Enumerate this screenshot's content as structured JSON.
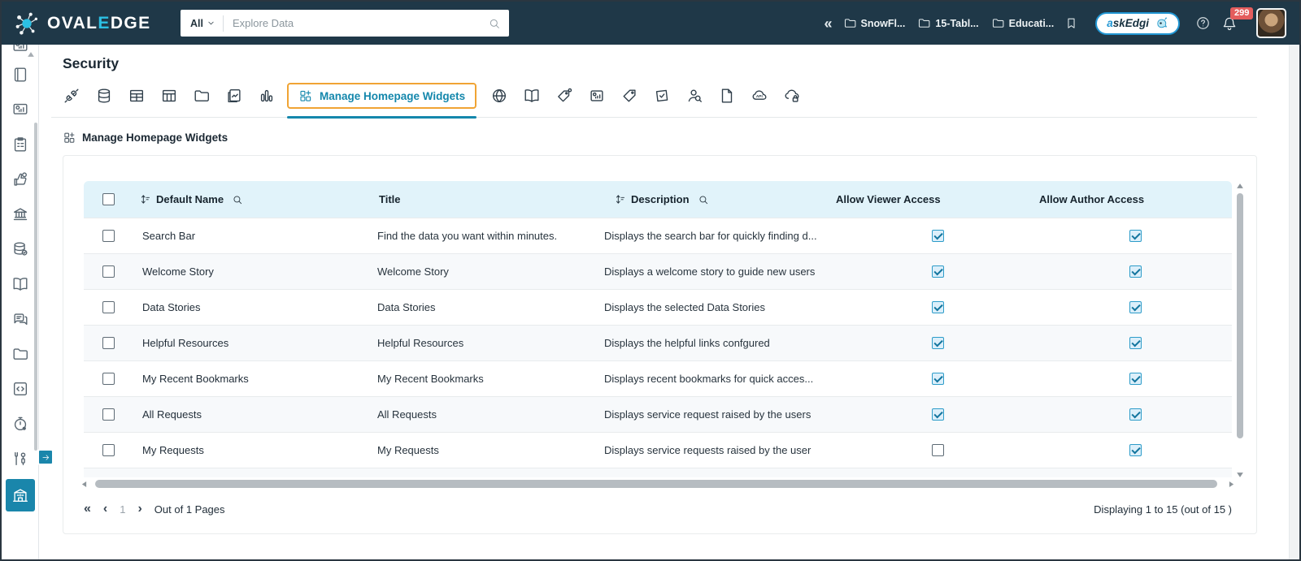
{
  "topbar": {
    "logo_oval": "OVAL",
    "logo_e": "E",
    "logo_dge": "DGE",
    "search_scope": "All",
    "search_placeholder": "Explore Data",
    "collapse_glyph": "«",
    "recent_tabs": [
      {
        "label": "SnowFl..."
      },
      {
        "label": "15-Tabl..."
      },
      {
        "label": "Educati..."
      }
    ],
    "ask_edgi_first": "a",
    "ask_edgi_rest": "skEdgi",
    "notifications_count": "299"
  },
  "sidebar": {
    "items": [
      {
        "icon": "dashboard",
        "name": "cut-top",
        "cut": true
      },
      {
        "icon": "journal",
        "name": "journal"
      },
      {
        "icon": "dashboard",
        "name": "dashboard"
      },
      {
        "icon": "clipboard",
        "name": "clipboard"
      },
      {
        "icon": "endorse",
        "name": "endorse"
      },
      {
        "icon": "bank",
        "name": "governance"
      },
      {
        "icon": "db-check",
        "name": "data-quality"
      },
      {
        "icon": "book",
        "name": "glossary"
      },
      {
        "icon": "chat",
        "name": "collaboration"
      },
      {
        "icon": "folder",
        "name": "files"
      },
      {
        "icon": "code",
        "name": "query-sheet"
      },
      {
        "icon": "timer",
        "name": "jobs"
      },
      {
        "icon": "tools",
        "name": "tools"
      },
      {
        "icon": "building",
        "name": "security",
        "active": true
      }
    ]
  },
  "page": {
    "title": "Security",
    "tab_icons_left": [
      {
        "icon": "plug",
        "name": "connectors"
      },
      {
        "icon": "database",
        "name": "databases"
      },
      {
        "icon": "table",
        "name": "tables"
      },
      {
        "icon": "table-cols",
        "name": "table-columns"
      },
      {
        "icon": "folder",
        "name": "folders"
      },
      {
        "icon": "note-chart",
        "name": "queries"
      },
      {
        "icon": "bars",
        "name": "reports"
      }
    ],
    "active_tab_label": "Manage Homepage Widgets",
    "tab_icons_right": [
      {
        "icon": "globe",
        "name": "domains"
      },
      {
        "icon": "book",
        "name": "glossary"
      },
      {
        "icon": "tag-dot",
        "name": "terms"
      },
      {
        "icon": "image-chart",
        "name": "report-items"
      },
      {
        "icon": "tag",
        "name": "tags"
      },
      {
        "icon": "check-square",
        "name": "approvals"
      },
      {
        "icon": "person-search",
        "name": "user-audit"
      },
      {
        "icon": "document",
        "name": "documents"
      },
      {
        "icon": "cloud-api",
        "name": "api-access"
      },
      {
        "icon": "cloud-lock",
        "name": "api-security"
      }
    ],
    "section_title": "Manage Homepage Widgets"
  },
  "table": {
    "columns": {
      "default_name": "Default Name",
      "title": "Title",
      "description": "Description",
      "viewer": "Allow Viewer Access",
      "author": "Allow Author Access"
    },
    "rows": [
      {
        "default_name": "Search Bar",
        "title": "Find the data you want within minutes.",
        "description": "Displays the search bar for quickly finding d...",
        "viewer_checked": true,
        "author_checked": true
      },
      {
        "default_name": "Welcome Story",
        "title": "Welcome Story",
        "description": "Displays a welcome story to guide new users",
        "viewer_checked": true,
        "author_checked": true
      },
      {
        "default_name": "Data Stories",
        "title": "Data Stories",
        "description": "Displays the selected Data Stories",
        "viewer_checked": true,
        "author_checked": true
      },
      {
        "default_name": "Helpful Resources",
        "title": "Helpful Resources",
        "description": "Displays the helpful links confgured",
        "viewer_checked": true,
        "author_checked": true
      },
      {
        "default_name": "My Recent Bookmarks",
        "title": "My Recent Bookmarks",
        "description": "Displays recent bookmarks for quick acces...",
        "viewer_checked": true,
        "author_checked": true
      },
      {
        "default_name": "All Requests",
        "title": "All Requests",
        "description": "Displays service request raised by the users",
        "viewer_checked": true,
        "author_checked": true
      },
      {
        "default_name": "My Requests",
        "title": "My Requests",
        "description": "Displays service requests raised by the user",
        "viewer_checked": false,
        "author_checked": true
      }
    ]
  },
  "pagination": {
    "first_glyph": "«",
    "prev_glyph": "‹",
    "page": "1",
    "next_glyph": "›",
    "pages_label": "Out of 1 Pages",
    "displaying_label": "Displaying 1 to 15  (out of 15 )"
  },
  "colors": {
    "topbar_bg": "#1f3848",
    "accent_cyan": "#2cc0e4",
    "accent_teal": "#1487ac",
    "annotation_orange": "#f0a434",
    "table_header_bg": "#e1f3fa",
    "badge_red": "#e45d5d"
  }
}
